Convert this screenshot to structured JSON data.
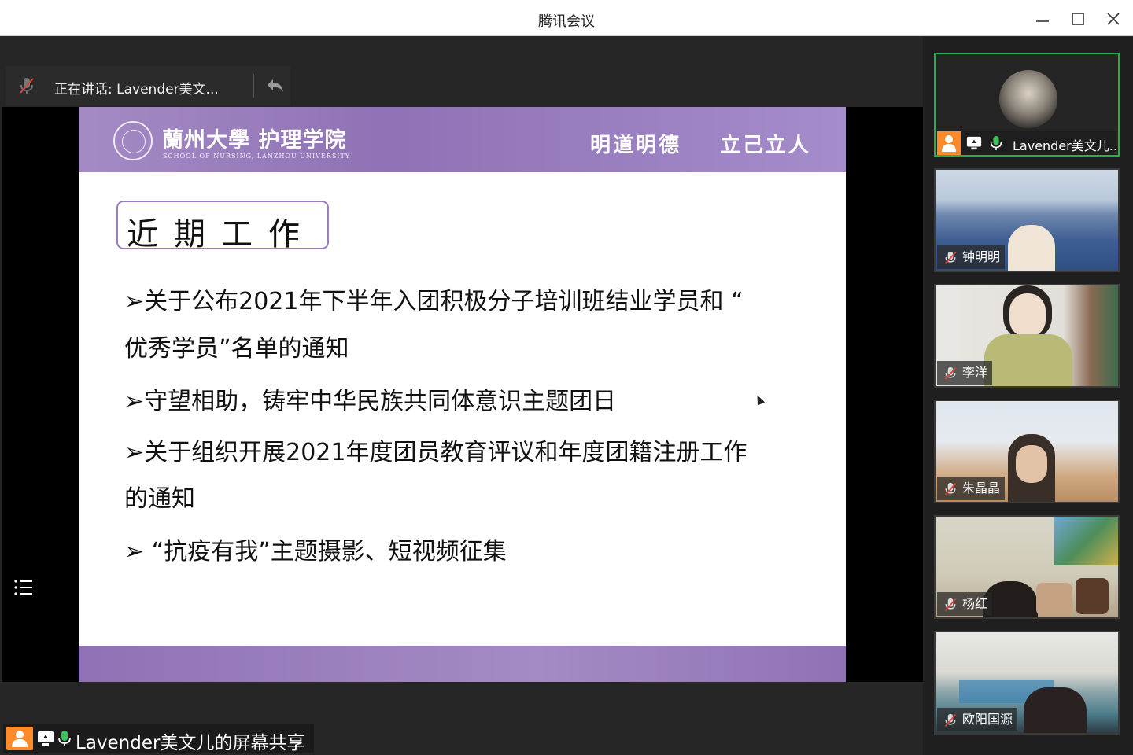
{
  "window": {
    "title": "腾讯会议"
  },
  "speaking": {
    "text": "正在讲话: Lavender美文..."
  },
  "slide": {
    "university": "蘭州大學 护理学院",
    "university_en": "SCHOOL OF NURSING, LANZHOU UNIVERSITY",
    "motto_left": "明道明德",
    "motto_right": "立己立人",
    "title": "近期工作",
    "bullets": [
      "➢关于公布2021年下半年入团积极分子培训班结业学员和 “",
      "优秀学员”名单的通知",
      "➢守望相助，铸牢中华民族共同体意识主题团日",
      "➢关于组织开展2021年度团员教育评议和年度团籍注册工作",
      "的通知",
      "➢ “抗疫有我”主题摄影、短视频征集"
    ]
  },
  "share": {
    "label": "Lavender美文儿的屏幕共享"
  },
  "participants": [
    {
      "name": "Lavender美文儿..."
    },
    {
      "name": "钟明明"
    },
    {
      "name": "李洋"
    },
    {
      "name": "朱晶晶"
    },
    {
      "name": "杨红"
    },
    {
      "name": "欧阳国源"
    }
  ],
  "colors": {
    "accent": "#22b14c",
    "host_badge": "#ff8a2a",
    "slide_purple": "#9a7dbd"
  },
  "icons": [
    "minimize-icon",
    "maximize-icon",
    "close-icon",
    "mic-muted-icon",
    "undo-icon",
    "list-icon",
    "host-icon",
    "screen-share-icon",
    "mic-on-icon"
  ]
}
